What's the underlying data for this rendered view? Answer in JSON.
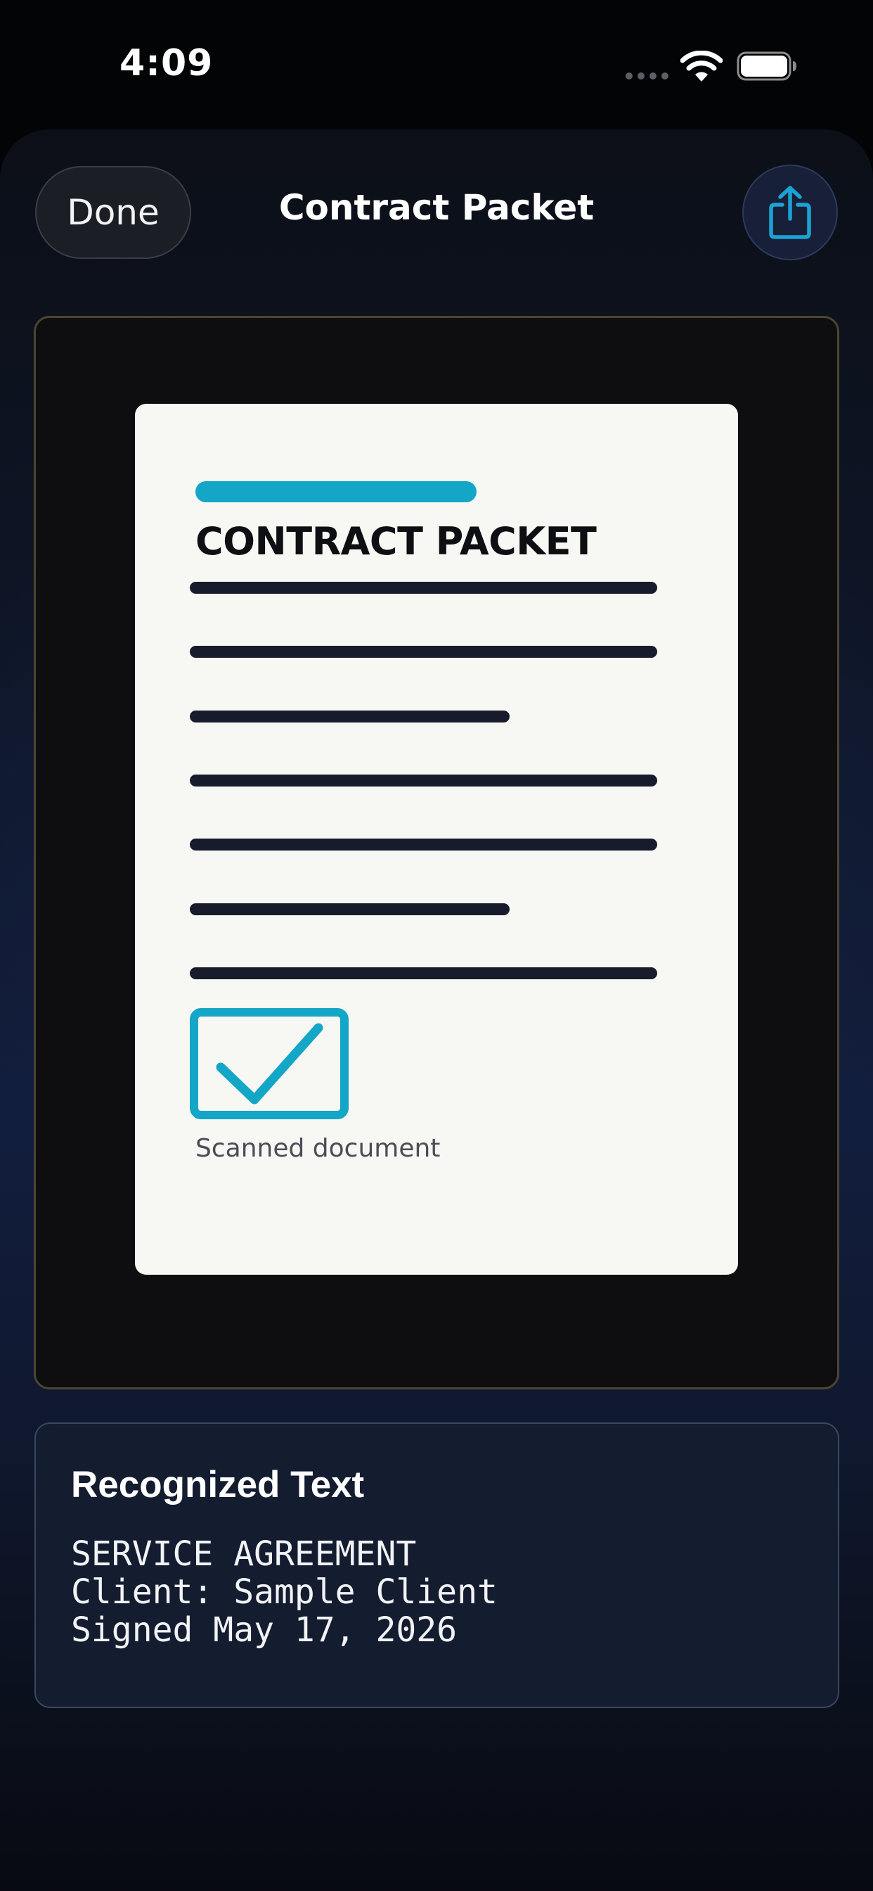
{
  "status_bar": {
    "time": "4:09",
    "icons": [
      "signal-dots-icon",
      "wifi-icon",
      "battery-icon"
    ]
  },
  "nav": {
    "done_label": "Done",
    "title": "Contract Packet",
    "share_icon": "share-icon"
  },
  "document_preview": {
    "heading": "CONTRACT PACKET",
    "caption": "Scanned document",
    "checkbox_icon": "checkbox-checked-icon",
    "accent_color": "#14a6c7",
    "line_color": "#171b2b"
  },
  "recognized_text": {
    "title": "Recognized Text",
    "lines": [
      "SERVICE AGREEMENT",
      "Client: Sample Client",
      "Signed May 17, 2026"
    ]
  },
  "colors": {
    "accent": "#14a6c7",
    "share_icon": "#1aa3d4",
    "background_top": "#030406",
    "frame_border": "#4c4530",
    "card_border": "#3a4762"
  }
}
